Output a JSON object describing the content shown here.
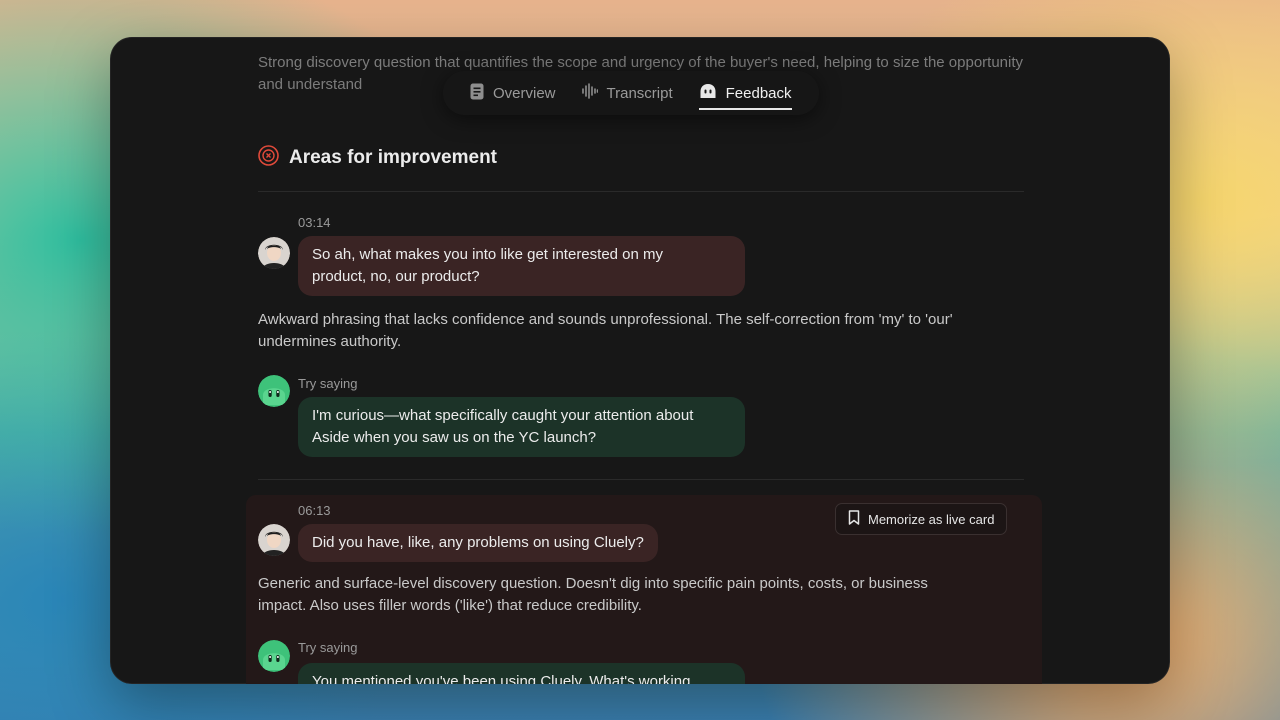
{
  "intro_text": "Strong discovery question that quantifies the scope and urgency of the buyer's need, helping to size the opportunity and understand",
  "tabs": [
    {
      "label": "Overview",
      "icon": "document-icon",
      "active": false
    },
    {
      "label": "Transcript",
      "icon": "waveform-icon",
      "active": false
    },
    {
      "label": "Feedback",
      "icon": "feedback-icon",
      "active": true
    }
  ],
  "section": {
    "title": "Areas for improvement",
    "icon": "target-icon",
    "accent": "#e04a3a"
  },
  "items": [
    {
      "timestamp": "03:14",
      "quote_lines": [
        "So ah, what makes you into like get interested on my",
        "product, no, our product?"
      ],
      "feedback_lines": [
        "Awkward phrasing that lacks confidence and sounds unprofessional. The self-correction from 'my' to 'our'",
        "undermines authority."
      ],
      "try_label": "Try saying",
      "suggestion_lines": [
        "I'm curious—what specifically caught your attention about",
        "Aside when you saw us on the YC launch?"
      ]
    },
    {
      "timestamp": "06:13",
      "quote_lines": [
        "Did you have, like, any problems on using Cluely?"
      ],
      "feedback_lines": [
        "Generic and surface-level discovery question. Doesn't dig into specific pain points, costs, or business",
        "impact. Also uses filler words ('like') that reduce credibility."
      ],
      "try_label": "Try saying",
      "suggestion_lines": [
        "You mentioned you've been using Cluely. What's working"
      ],
      "memorize_label": "Memorize as live card"
    }
  ],
  "colors": {
    "user_bubble": "#3a2424",
    "suggest_bubble": "#1c3328",
    "assistant_avatar": "#3ec27a"
  }
}
